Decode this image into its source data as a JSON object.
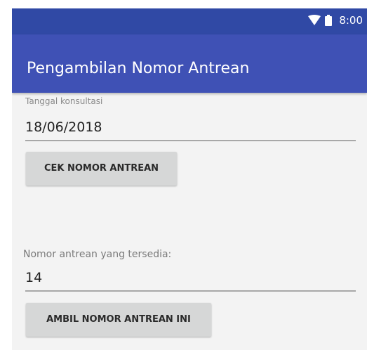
{
  "status_bar": {
    "time": "8:00",
    "icons": [
      "wifi-icon",
      "battery-icon"
    ]
  },
  "app_bar": {
    "title": "Pengambilan Nomor Antrean"
  },
  "form": {
    "date_label": "Tanggal konsultasi",
    "date_value": "18/06/2018",
    "check_button_label": "CEK NOMOR ANTREAN",
    "queue_label": "Nomor antrean yang tersedia:",
    "queue_value": "14",
    "take_button_label": "AMBIL NOMOR ANTREAN INI"
  },
  "colors": {
    "status_bar": "#3049a5",
    "app_bar": "#3f51b5",
    "button": "#d6d7d7",
    "background": "#f3f3f3"
  }
}
